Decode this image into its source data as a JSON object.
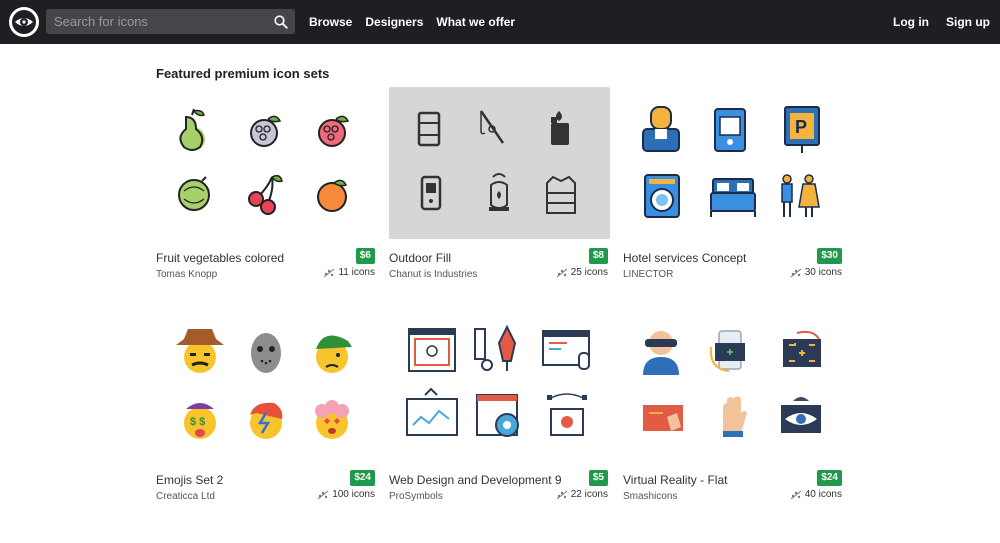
{
  "header": {
    "search_placeholder": "Search for icons",
    "nav": [
      "Browse",
      "Designers",
      "What we offer"
    ],
    "auth": [
      "Log in",
      "Sign up"
    ]
  },
  "section_title": "Featured premium icon sets",
  "colors": {
    "topbar": "#1e1f22",
    "price_badge": "#1f9a4a",
    "selected_thumb": "#d6d6d6"
  },
  "cards": [
    {
      "name": "Fruit vegetables colored",
      "author": "Tomas Knopp",
      "price": "$6",
      "count": "11 icons",
      "icons": [
        "pear-icon",
        "mulberry-icon",
        "raspberry-icon",
        "gooseberry-icon",
        "cherries-icon",
        "orange-icon"
      ]
    },
    {
      "name": "Outdoor Fill",
      "author": "Chanut is Industries",
      "price": "$8",
      "count": "25 icons",
      "icons": [
        "backpack-icon",
        "fishing-rod-icon",
        "lighter-icon",
        "radio-icon",
        "lantern-icon",
        "vest-icon"
      ]
    },
    {
      "name": "Hotel services Concept",
      "author": "LINECTOR",
      "price": "$30",
      "count": "30 icons",
      "icons": [
        "receptionist-icon",
        "key-card-icon",
        "parking-sign-icon",
        "washing-machine-icon",
        "bed-icon",
        "restroom-icon"
      ]
    },
    {
      "name": "Emojis Set 2",
      "author": "Creaticca Ltd",
      "price": "$24",
      "count": "100 icons",
      "icons": [
        "cowboy-emoji-icon",
        "hockey-mask-emoji-icon",
        "capped-emoji-icon",
        "money-emoji-icon",
        "rockstar-emoji-icon",
        "love-emoji-icon"
      ]
    },
    {
      "name": "Web Design and Development 9",
      "author": "ProSymbols",
      "price": "$5",
      "count": "22 icons",
      "icons": [
        "touch-screen-icon",
        "design-tools-icon",
        "code-window-icon",
        "dashboard-board-icon",
        "settings-layout-icon",
        "video-vector-icon"
      ]
    },
    {
      "name": "Virtual Reality - Flat",
      "author": "Smashicons",
      "price": "$24",
      "count": "40 icons",
      "icons": [
        "vr-headset-user-icon",
        "rotate-phone-icon",
        "rotate-screen-icon",
        "vr-touch-icon",
        "vr-glove-icon",
        "vr-eye-icon"
      ]
    }
  ]
}
